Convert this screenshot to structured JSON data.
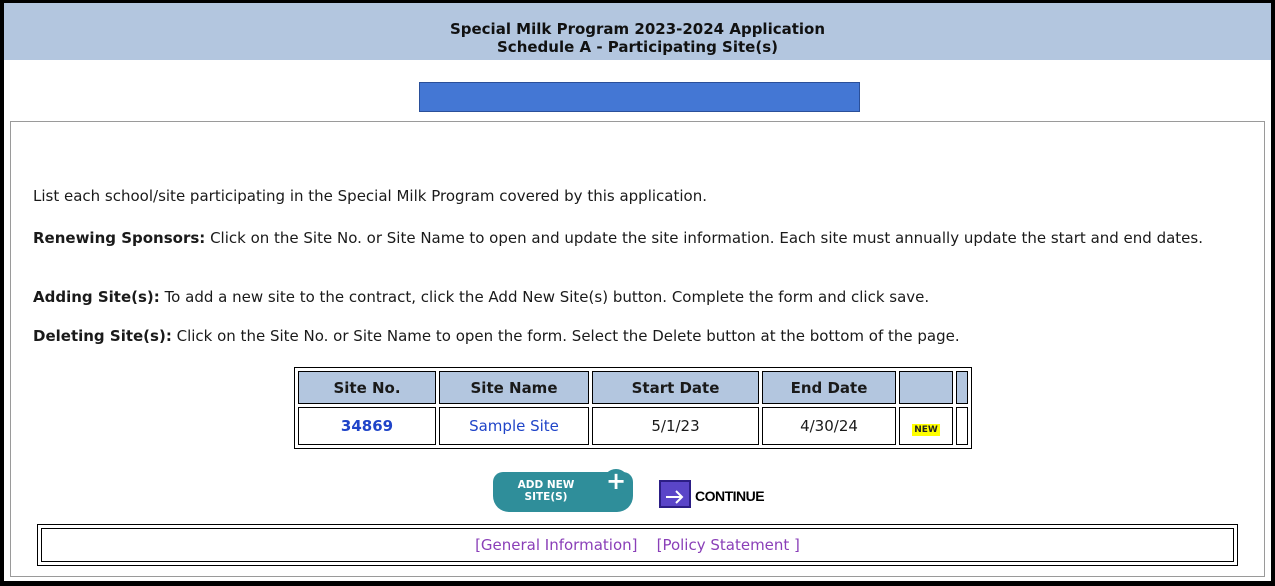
{
  "header": {
    "title_line1": "Special Milk Program 2023-2024 Application",
    "title_line2": "Schedule A - Participating Site(s)"
  },
  "intro": "List each school/site participating in the Special Milk Program covered by this application.",
  "renewing": {
    "label": "Renewing Sponsors:",
    "text": " Click on the Site No. or Site Name to open and update the site information. Each site must annually update the start and end dates."
  },
  "adding": {
    "label": "Adding Site(s):",
    "text": " To add a new site to the contract, click the Add New Site(s) button. Complete the form and click save."
  },
  "deleting": {
    "label": "Deleting Site(s):",
    "text": " Click on the Site No. or Site Name to open the form. Select the Delete button at the bottom of the page."
  },
  "table": {
    "headers": [
      "Site No.",
      "Site Name",
      "Start Date",
      "End Date"
    ],
    "rows": [
      {
        "site_no": "34869",
        "site_name": "Sample Site",
        "start_date": "5/1/23",
        "end_date": "4/30/24",
        "badge": "NEW"
      }
    ]
  },
  "buttons": {
    "add_line1": "ADD NEW",
    "add_line2": "SITE(S)",
    "add_icon": "plus-icon",
    "continue_label": "CONTINUE",
    "continue_icon": "arrow-right-icon"
  },
  "footer": {
    "link1": "[General Information]",
    "link2": "[Policy Statement ]"
  },
  "colors": {
    "header_bg": "#b3c6df",
    "progress_bar": "#4477d4",
    "link": "#1f44c8",
    "footer_link": "#8a3fb8",
    "add_button": "#2f8e9a",
    "badge_bg": "#ffff00"
  }
}
